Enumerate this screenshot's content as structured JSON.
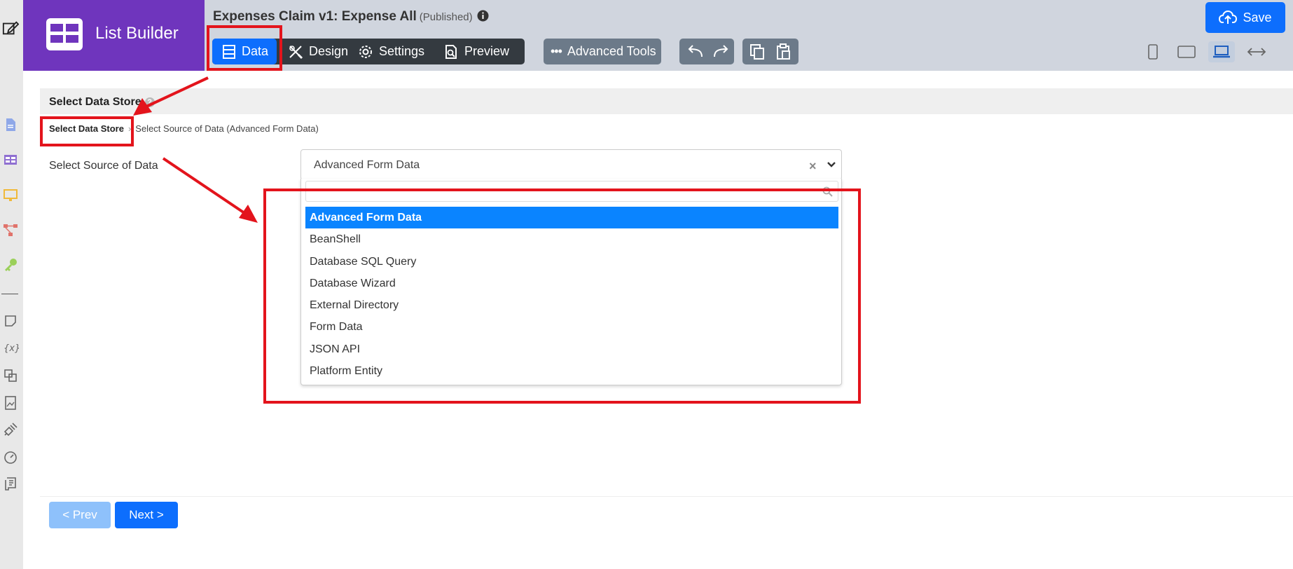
{
  "app": {
    "brand": "List Builder",
    "form_title": "Expenses Claim v1: Expense All",
    "form_status": "(Published)"
  },
  "tabs": [
    {
      "label": "Data",
      "icon": "data-icon",
      "active": true
    },
    {
      "label": "Design",
      "icon": "design-icon",
      "active": false
    },
    {
      "label": "Settings",
      "icon": "gear-icon",
      "active": false
    },
    {
      "label": "Preview",
      "icon": "preview-icon",
      "active": false
    }
  ],
  "toolbar": {
    "advanced_tools_label": "Advanced Tools",
    "save_label": "Save"
  },
  "panel": {
    "title": "Select Data Store",
    "breadcrumb": {
      "current": "Select Data Store",
      "next": "Select Source of Data (Advanced Form Data)"
    },
    "field_label": "Select Source of Data",
    "select": {
      "value": "Advanced Form Data",
      "search_value": "",
      "options": [
        "Advanced Form Data",
        "BeanShell",
        "Database SQL Query",
        "Database Wizard",
        "External Directory",
        "Form Data",
        "JSON API",
        "Platform Entity"
      ],
      "selected_index": 0
    }
  },
  "nav": {
    "prev_label": "< Prev",
    "next_label": "Next >"
  },
  "colors": {
    "brand_purple": "#6f35bd",
    "primary_blue": "#0d6efd",
    "highlight_red": "#e3141c",
    "topbar_gray": "#d0d5de"
  }
}
